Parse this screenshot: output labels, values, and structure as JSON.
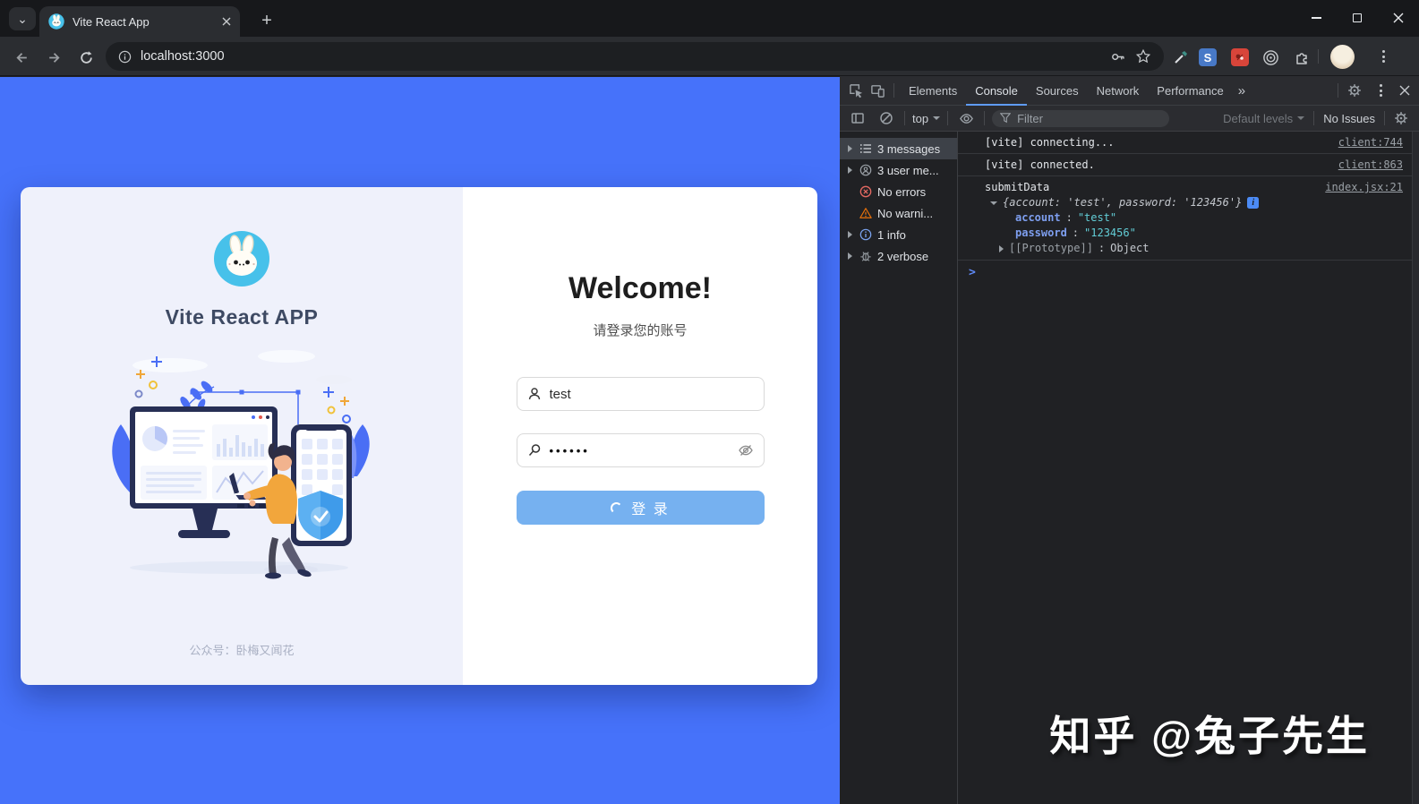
{
  "browser": {
    "tab_title": "Vite React App",
    "url": "localhost:3000"
  },
  "icons": {
    "tab_search": "⌄",
    "new_tab": "+",
    "more_tabs": "»",
    "s_extension": "S"
  },
  "devtools": {
    "tabs": [
      "Elements",
      "Console",
      "Sources",
      "Network",
      "Performance"
    ],
    "active_tab": "Console",
    "context_selector": "top",
    "filter_placeholder": "Filter",
    "levels_selector": "Default levels",
    "issues_label": "No Issues",
    "sidebar": [
      "3 messages",
      "3 user me...",
      "No errors",
      "No warni...",
      "1 info",
      "2 verbose"
    ],
    "selected_sidebar_item": "3 messages",
    "console": {
      "colon": ":",
      "rows": [
        {
          "text": "[vite] connecting...",
          "link": "client:744"
        },
        {
          "text": "[vite] connected.",
          "link": "client:863"
        }
      ],
      "group": {
        "label": "submitData",
        "link": "index.jsx:21",
        "preview": "{account: 'test', password: '123456'}",
        "info_badge": "i",
        "props": [
          {
            "key": "account",
            "value": "\"test\""
          },
          {
            "key": "password",
            "value": "\"123456\""
          }
        ],
        "prototype_key": "[[Prototype]]",
        "prototype_value": "Object"
      },
      "prompt": ">"
    }
  },
  "app": {
    "brand": "Vite React APP",
    "welcome": "Welcome!",
    "subtitle": "请登录您的账号",
    "account_value": "test",
    "password_masked": "••••••",
    "login_label": "登 录",
    "footer": "公众号：卧梅又闻花"
  },
  "watermark": {
    "text": "知乎 @兔子先生"
  },
  "colors": {
    "page_accent": "#4672fa",
    "card_left_bg": "#eff1fb",
    "login_button": "#76b1f0",
    "logo_blue": "#47c1ea",
    "devtools_accent": "#5f9bf5",
    "console_key": "#7e9ff0",
    "console_string": "#62cdd6"
  }
}
